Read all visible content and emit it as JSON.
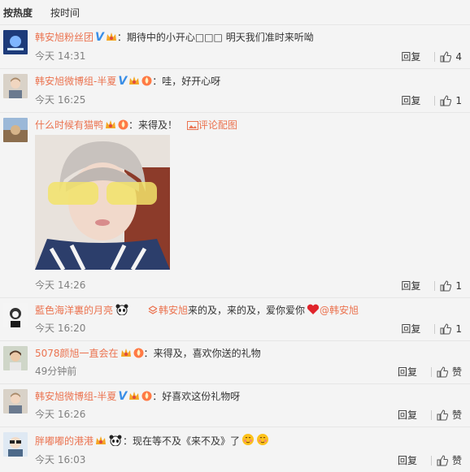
{
  "tabs": {
    "hot": "按热度",
    "time": "按时间"
  },
  "comments": [
    {
      "user": "韩安旭粉丝团",
      "sep": "：",
      "text": "期待中的小开心□□□ 明天我们准时来听呦",
      "time": "今天 14:31",
      "reply": "回复",
      "likes": "4"
    },
    {
      "user": "韩安旭微博组-半夏",
      "sep": "：",
      "text": "哇，好开心呀",
      "time": "今天 16:25",
      "reply": "回复",
      "likes": "1"
    },
    {
      "user": "什么时候有猫鸭",
      "sep": "：",
      "text": "来得及！",
      "pic_link": "评论配图",
      "time": "今天 14:26",
      "reply": "回复",
      "likes": "1"
    },
    {
      "user": "藍色海洋裏的月亮",
      "forward_user": "韩安旭",
      "text": "来的及，来的及，爱你爱你",
      "mention": "@韩安旭",
      "time": "今天 16:20",
      "reply": "回复",
      "likes": "1"
    },
    {
      "user": "5078颜旭一直会在",
      "sep": "：",
      "text": "来得及，喜欢你送的礼物",
      "time": "49分钟前",
      "reply": "回复",
      "likes": "赞"
    },
    {
      "user": "韩安旭微博组-半夏",
      "sep": "：",
      "text": "好喜欢这份礼物呀",
      "time": "今天 16:26",
      "reply": "回复",
      "likes": "赞"
    },
    {
      "user": "胖嘟嘟的港港",
      "sep": "：",
      "text": "现在等不及《来不及》了",
      "time": "今天 16:03",
      "reply": "回复",
      "likes": "赞"
    }
  ],
  "colors": {
    "username": "#eb7350",
    "vip_blue": "#3a8ee6",
    "background": "#f4f4f4"
  },
  "icons": [
    "verified-v-icon",
    "vip-crown-badge",
    "fire-badge",
    "panda-icon",
    "retweet-icon",
    "heart-icon",
    "thumbs-up-icon",
    "picture-icon",
    "blush-emoji"
  ]
}
